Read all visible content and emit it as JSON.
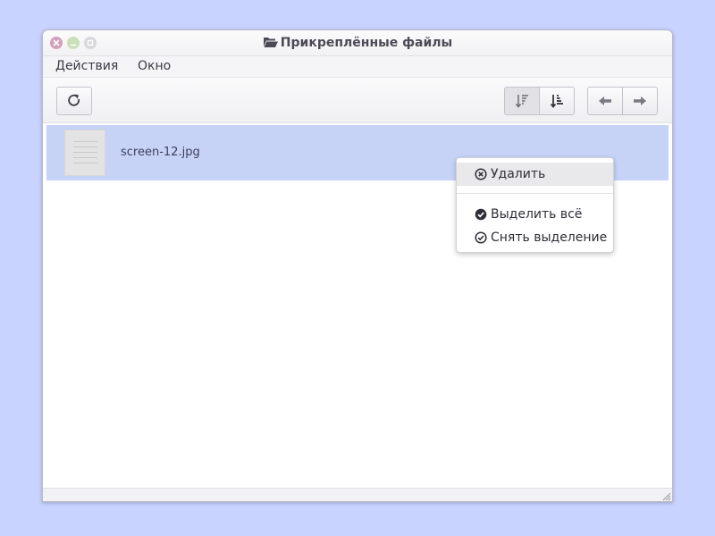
{
  "window": {
    "title": "Прикреплённые файлы",
    "title_icon": "folder-open-icon",
    "controls": [
      "close-icon",
      "minimize-icon",
      "maximize-icon"
    ]
  },
  "menubar": {
    "items": [
      {
        "label": "Действия"
      },
      {
        "label": "Окно"
      }
    ]
  },
  "toolbar": {
    "refresh_icon": "refresh-icon",
    "sort_desc_icon": "sort-descending-icon",
    "sort_asc_icon": "sort-ascending-icon",
    "back_icon": "arrow-left-icon",
    "forward_icon": "arrow-right-icon"
  },
  "files": [
    {
      "name": "screen-12.jpg",
      "icon": "file-thumbnail-icon",
      "selected": true
    }
  ],
  "context_menu": {
    "items": [
      {
        "label": "Удалить",
        "icon": "delete-circle-icon"
      },
      {
        "label": "Выделить всё",
        "icon": "check-circle-filled-icon"
      },
      {
        "label": "Снять выделение",
        "icon": "check-circle-outline-icon"
      }
    ]
  },
  "colors": {
    "desktop": "#c9d3ff",
    "selection": "#c6d3f7",
    "close_button": "#d3a0bc",
    "minimize_button": "#cbe0b8"
  }
}
